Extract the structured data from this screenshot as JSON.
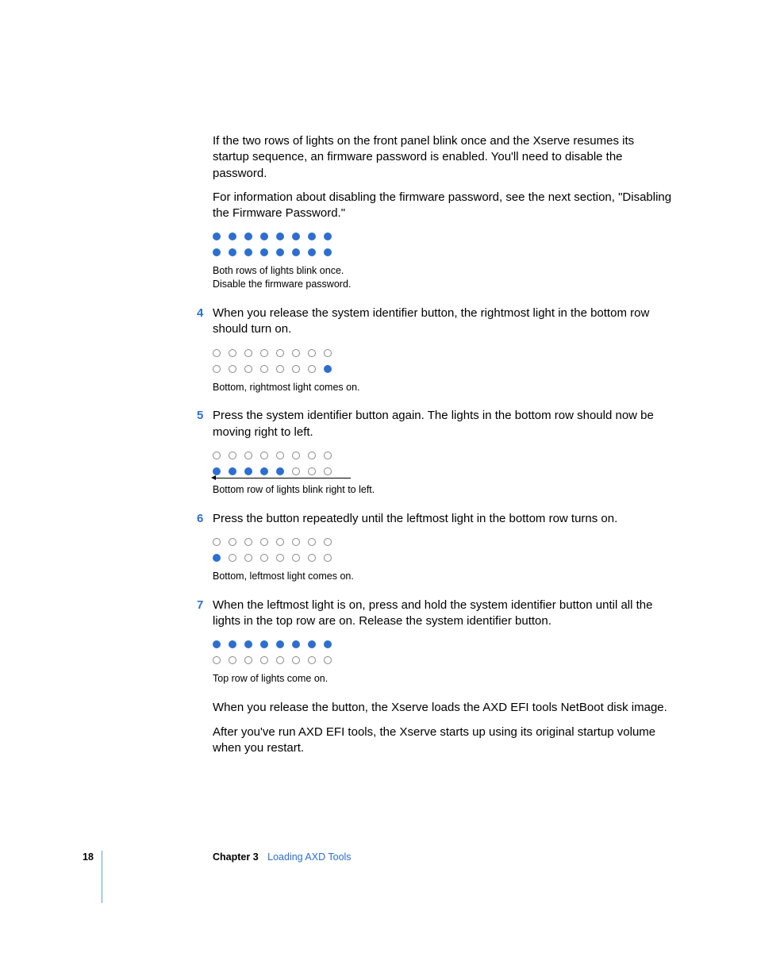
{
  "intro": {
    "p1": "If the two rows of lights on the front panel blink once and the Xserve resumes its startup sequence, an firmware password is enabled. You'll need to disable the password.",
    "p2": "For information about disabling the firmware password, see the next section, \"Disabling the Firmware Password.\""
  },
  "fig1": {
    "top": [
      "on",
      "on",
      "on",
      "on",
      "on",
      "on",
      "on",
      "on"
    ],
    "bottom": [
      "on",
      "on",
      "on",
      "on",
      "on",
      "on",
      "on",
      "on"
    ],
    "caption1": "Both rows of lights blink once.",
    "caption2": "Disable the firmware password."
  },
  "step4": {
    "num": "4",
    "text": "When you release the system identifier button, the rightmost light in the bottom row should turn on.",
    "top": [
      "off",
      "off",
      "off",
      "off",
      "off",
      "off",
      "off",
      "off"
    ],
    "bottom": [
      "off",
      "off",
      "off",
      "off",
      "off",
      "off",
      "off",
      "on"
    ],
    "caption": "Bottom, rightmost light comes on."
  },
  "step5": {
    "num": "5",
    "text": "Press the system identifier button again. The lights in the bottom row should now be moving right to left.",
    "top": [
      "off",
      "off",
      "off",
      "off",
      "off",
      "off",
      "off",
      "off"
    ],
    "bottom": [
      "on",
      "on",
      "on",
      "on",
      "on",
      "off",
      "off",
      "off"
    ],
    "caption": "Bottom row of lights blink right to left."
  },
  "step6": {
    "num": "6",
    "text": "Press the button repeatedly until the leftmost light in the bottom row turns on.",
    "top": [
      "off",
      "off",
      "off",
      "off",
      "off",
      "off",
      "off",
      "off"
    ],
    "bottom": [
      "on",
      "off",
      "off",
      "off",
      "off",
      "off",
      "off",
      "off"
    ],
    "caption": "Bottom, leftmost light comes on."
  },
  "step7": {
    "num": "7",
    "text": "When the leftmost light is on, press and hold the system identifier button until all the lights in the top row are on. Release the system identifier button.",
    "top": [
      "on",
      "on",
      "on",
      "on",
      "on",
      "on",
      "on",
      "on"
    ],
    "bottom": [
      "off",
      "off",
      "off",
      "off",
      "off",
      "off",
      "off",
      "off"
    ],
    "caption": "Top row of lights come on."
  },
  "closing": {
    "p1": "When you release the button, the Xserve loads the AXD EFI tools NetBoot disk image.",
    "p2": "After you've run AXD EFI tools, the Xserve starts up using its original startup volume when you restart."
  },
  "footer": {
    "page": "18",
    "chapter": "Chapter 3",
    "title": "Loading AXD Tools"
  }
}
